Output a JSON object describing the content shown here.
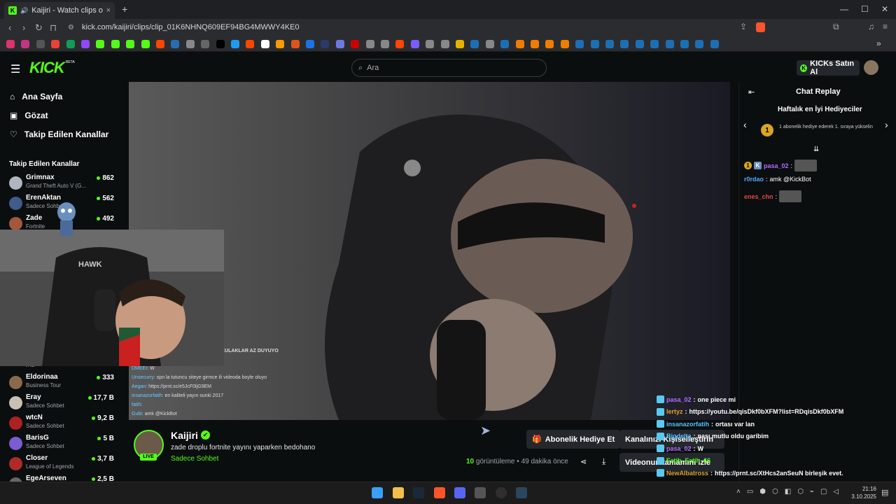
{
  "browser": {
    "tab_title": "Kaijiri - Watch clips on Kick",
    "url": "kick.com/kaijiri/clips/clip_01K6NHNQ609EF94BG4MWWY4KE0",
    "new_tab": "+",
    "close_tab": "×",
    "win_min": "—",
    "win_max": "☐",
    "win_close": "✕",
    "bookmark_colors": [
      "#e1306c",
      "#c13584",
      "#555",
      "#ea4335",
      "#0f9d58",
      "#9146ff",
      "#53fc18",
      "#53fc18",
      "#53fc18",
      "#53fc18",
      "#ff4500",
      "#2b6cb0",
      "#888",
      "#666",
      "#000",
      "#1d9bf0",
      "#ff4500",
      "#fff",
      "#ff9900",
      "#e0541b",
      "#1a73e8",
      "#2b3a67",
      "#6c7ae0",
      "#c00",
      "#888",
      "#888",
      "#ff4500",
      "#7b5cff",
      "#888",
      "#888",
      "#e6b400",
      "#1b6fb5",
      "#888",
      "#1b6fb5",
      "#ef7d00",
      "#ef7d00",
      "#ef7d00",
      "#ef7d00",
      "#1b6fb5",
      "#1b6fb5",
      "#1b6fb5",
      "#1b6fb5",
      "#1b6fb5",
      "#1b6fb5",
      "#1b6fb5",
      "#1b6fb5",
      "#1b6fb5",
      "#1b6fb5"
    ]
  },
  "header": {
    "logo": "KICK",
    "logo_beta": "BETA",
    "search_placeholder": "Ara",
    "buy_kicks": "KICKs Satın Al"
  },
  "sidebar": {
    "nav": [
      {
        "label": "Ana Sayfa",
        "icon": "home-icon",
        "glyph": "⌂"
      },
      {
        "label": "Gözat",
        "icon": "browse-icon",
        "glyph": "▣"
      },
      {
        "label": "Takip Edilen Kanallar",
        "icon": "heart-icon",
        "glyph": "♡"
      }
    ],
    "followed_heading": "Takip Edilen Kanallar",
    "channels": [
      {
        "name": "Grimnax",
        "game": "Grand Theft Auto V (G...",
        "viewers": "862",
        "color": "#b0b6c0"
      },
      {
        "name": "ErenAktan",
        "game": "Sadece Sohbet",
        "viewers": "562",
        "color": "#3f5c8a"
      },
      {
        "name": "Zade",
        "game": "Fortnite",
        "viewers": "492",
        "color": "#a3583c"
      },
      {
        "name": "Eldorinaa",
        "game": "Business Tour",
        "viewers": "333",
        "color": "#8a6a4a"
      },
      {
        "name": "Eray",
        "game": "Sadece Sohbet",
        "viewers": "17,7 B",
        "color": "#c9c0b5"
      },
      {
        "name": "wtcN",
        "game": "Sadece Sohbet",
        "viewers": "9,2 B",
        "color": "#aa2222"
      },
      {
        "name": "BarisG",
        "game": "Sadece Sohbet",
        "viewers": "5 B",
        "color": "#7a5dd0"
      },
      {
        "name": "Closer",
        "game": "League of Legends",
        "viewers": "3,7 B",
        "color": "#b02a2a"
      },
      {
        "name": "EgeArseven",
        "game": "",
        "viewers": "2,5 B",
        "color": "#666"
      }
    ],
    "partial_category": "IRL"
  },
  "player": {
    "overlay_caption": "KULAKLAR AZ DUYUYO",
    "overlay_chat": [
      {
        "user": "DMEEI",
        "text": "W"
      },
      {
        "user": "Unsecurry",
        "text": "spn la tutuncu siteye girmce ili videoda boyle oluyo"
      },
      {
        "user": "Aegan",
        "text": "https://prnt.sc/e5JcF0ljG9EM"
      },
      {
        "user": "insanazorfatih",
        "text": "en kaliteli yayın sunki 2017"
      },
      {
        "user": "fatih",
        "text": ""
      },
      {
        "user": "Gubi",
        "text": "amk @KickBot"
      }
    ],
    "webcam_brand": "HAWK"
  },
  "clip": {
    "channel": "Kaijiri",
    "verified": "✔",
    "live": "LIVE",
    "title": "zade droplu fortnite yayını yaparken bedohano",
    "category": "Sadece Sohbet",
    "views_count": "10",
    "views_label": "görüntüleme",
    "time_ago": "49 dakika önce",
    "gift_sub": "Abonelik Hediye Et",
    "customize": "Kanalınızı Kişiselleştirin",
    "watch_full": "Videonun tamamını izle"
  },
  "chat": {
    "title": "Chat Replay",
    "gifters_heading": "Haftalık en İyi Hediyeciler",
    "gifter_rank": "1",
    "gifter_text": "1 abonelik hediye ederek 1. sıraya yükselin",
    "messages": [
      {
        "user": "pasa_02",
        "user_color": "#b06cff",
        "text": "",
        "emote": true,
        "badge": true
      },
      {
        "user": "r0rdao",
        "user_color": "#53a8ff",
        "text": "amk @KickBot",
        "emote": false,
        "badge": false
      },
      {
        "user": "enes_chn",
        "user_color": "#e84545",
        "text": "",
        "emote": true,
        "badge": false
      }
    ]
  },
  "stream_overlay_chat": [
    {
      "user": "pasa_02",
      "color": "#b06cff",
      "text": "one piece mi"
    },
    {
      "user": "lertyz",
      "color": "#e0a030",
      "text": "https://youtu.be/qisDkf0bXFM?list=RDqisDkf0bXFM"
    },
    {
      "user": "insanazorfatih",
      "color": "#53c0ff",
      "text": "ortası var lan"
    },
    {
      "user": "Bigdelta",
      "color": "#53c0ff",
      "text": "nası mutlu oldu garibim"
    },
    {
      "user": "pasa_02",
      "color": "#b06cff",
      "text": "W"
    },
    {
      "user": "Fatih_Fatih_66",
      "color": "#53fc18",
      "text": ""
    },
    {
      "user": "NewAlbatross",
      "color": "#e0a030",
      "text": "https://prnt.sc/XtHcs2anSeuN birleşik evet."
    }
  ],
  "taskbar": {
    "time": "21:16",
    "date": "3.10.2025"
  }
}
